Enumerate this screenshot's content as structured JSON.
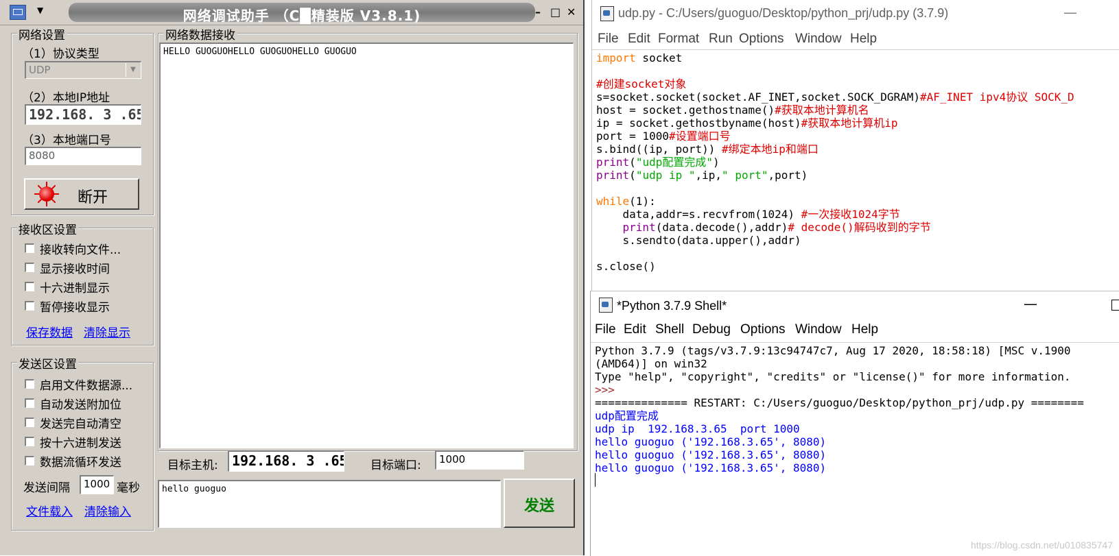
{
  "netassist": {
    "title": "网络调试助手 （C█精装版 V3.8.1)",
    "net_settings": {
      "group": "网络设置",
      "protocol_label": "（1）协议类型",
      "protocol_value": "UDP",
      "ip_label": "（2）本地IP地址",
      "ip_value": "192.168. 3 .65",
      "port_label": "（3）本地端口号",
      "port_value": "8080",
      "connect_button": "断开"
    },
    "recv_settings": {
      "group": "接收区设置",
      "options": [
        "接收转向文件...",
        "显示接收时间",
        "十六进制显示",
        "暂停接收显示"
      ],
      "save_link": "保存数据",
      "clear_link": "清除显示"
    },
    "send_settings": {
      "group": "发送区设置",
      "options": [
        "启用文件数据源...",
        "自动发送附加位",
        "发送完自动清空",
        "按十六进制发送",
        "数据流循环发送"
      ],
      "interval_label": "发送间隔",
      "interval_value": "1000",
      "interval_unit": "毫秒",
      "load_file_link": "文件载入",
      "clear_input_link": "清除输入"
    },
    "recv_area": {
      "group": "网络数据接收",
      "content": "HELLO GUOGUOHELLO GUOGUOHELLO GUOGUO"
    },
    "target": {
      "host_label": "目标主机:",
      "host_value": "192.168. 3 .65",
      "port_label": "目标端口:",
      "port_value": "1000"
    },
    "send_area": {
      "content": "hello guoguo",
      "send_button": "发送"
    }
  },
  "editor": {
    "title": "udp.py - C:/Users/guoguo/Desktop/python_prj/udp.py (3.7.9)",
    "menu": [
      "File",
      "Edit",
      "Format",
      "Run",
      "Options",
      "Window",
      "Help"
    ],
    "code": {
      "l1_kw": "import",
      "l1_rest": " socket",
      "l3": "#创建socket对象",
      "l4_code": "s=socket.socket(socket.AF_INET,socket.SOCK_DGRAM)",
      "l4_cm": "#AF_INET ipv4协议 SOCK_D",
      "l5_code": "host = socket.gethostname()",
      "l5_cm": "#获取本地计算机名",
      "l6_code": "ip = socket.gethostbyname(host)",
      "l6_cm": "#获取本地计算机ip",
      "l7_code": "port = 1000",
      "l7_cm": "#设置端口号",
      "l8_code": "s.bind((ip, port)) ",
      "l8_cm": "#绑定本地ip和端口",
      "l9_fn": "print",
      "l9_p1": "(",
      "l9_str": "\"udp配置完成\"",
      "l9_p2": ")",
      "l10_fn": "print",
      "l10_p1": "(",
      "l10_str1": "\"udp ip \"",
      "l10_mid": ",ip,",
      "l10_str2": "\" port\"",
      "l10_end": ",port)",
      "l12_kw": "while",
      "l12_rest": "(1):",
      "l13_code": "    data,addr=s.recvfrom(1024) ",
      "l13_cm": "#一次接收1024字节",
      "l14_indent": "    ",
      "l14_fn": "print",
      "l14_code": "(data.decode(),addr)",
      "l14_cm": "# decode()解码收到的字节",
      "l15_code": "    s.sendto(data.upper(),addr)",
      "l17_code": "s.close()"
    }
  },
  "shell": {
    "title": "*Python 3.7.9 Shell*",
    "menu": [
      "File",
      "Edit",
      "Shell",
      "Debug",
      "Options",
      "Window",
      "Help"
    ],
    "lines": {
      "banner1": "Python 3.7.9 (tags/v3.7.9:13c94747c7, Aug 17 2020, 18:58:18) [MSC v.1900",
      "banner2": "(AMD64)] on win32",
      "banner3": "Type \"help\", \"copyright\", \"credits\" or \"license()\" for more information.",
      "prompt": ">>>",
      "restart": "============== RESTART: C:/Users/guoguo/Desktop/python_prj/udp.py ========",
      "out1": "udp配置完成",
      "out2": "udp ip  192.168.3.65  port 1000",
      "out3": "hello guoguo ('192.168.3.65', 8080)",
      "out4": "hello guoguo ('192.168.3.65', 8080)",
      "out5": "hello guoguo ('192.168.3.65', 8080)"
    }
  },
  "watermark": "https://blog.csdn.net/u010835747",
  "colors": {
    "keyword": "#ff7700",
    "comment": "#dd0000",
    "string": "#00aa00",
    "builtin": "#900090",
    "shell_output": "#0000ff",
    "led": "#e00000",
    "send_button_text": "#008000"
  }
}
